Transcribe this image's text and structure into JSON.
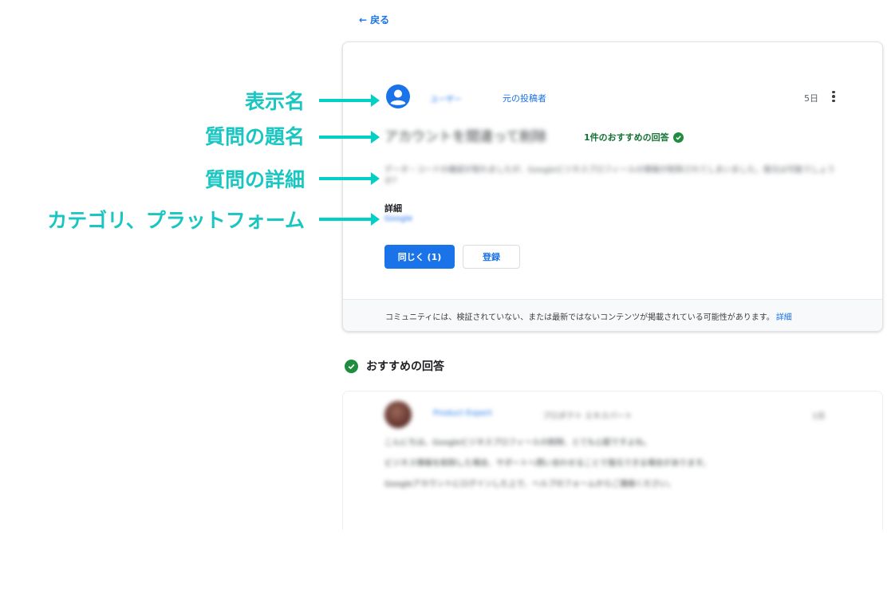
{
  "nav": {
    "back_label": "戻る"
  },
  "question": {
    "author_name": "ユーザー",
    "op_label": "元の投稿者",
    "timestamp": "5日",
    "title": "アカウントを間違って削除",
    "recommended_badge": "1件のおすすめの回答",
    "body": "データ・コードの確認が取れましたが、Googleビジネスプロフィールの情報が削除されてしまいました。復元は可能でしょうか？",
    "detail_label": "詳細",
    "detail_value": "Google",
    "same_button": "同じく (1)",
    "subscribe_button": "登録",
    "footer_text": "コミュニティには、検証されていない、または最新ではないコンテンツが掲載されている可能性があります。",
    "footer_link": "詳細"
  },
  "recommended": {
    "section_title": "おすすめの回答",
    "answer_author": "Product Expert",
    "answer_meta": "プロダクト エキスパート",
    "answer_time": "1日",
    "answer_paragraphs": [
      "こんにちは。Googleビジネスプロフィールの削除、とても心配ですよね。",
      "ビジネス情報を削除した場合、サポートへ問い合わせることで復元できる場合があります。",
      "Googleアカウントにログインした上で、ヘルプのフォームからご連絡ください。"
    ]
  },
  "annotations": {
    "display_name": "表示名",
    "question_title": "質問の題名",
    "question_detail": "質問の詳細",
    "category_platform": "カテゴリ、プラットフォーム"
  },
  "colors": {
    "accent": "#1a73e8",
    "annotation": "#19c6c1",
    "success": "#1e8e3e"
  }
}
